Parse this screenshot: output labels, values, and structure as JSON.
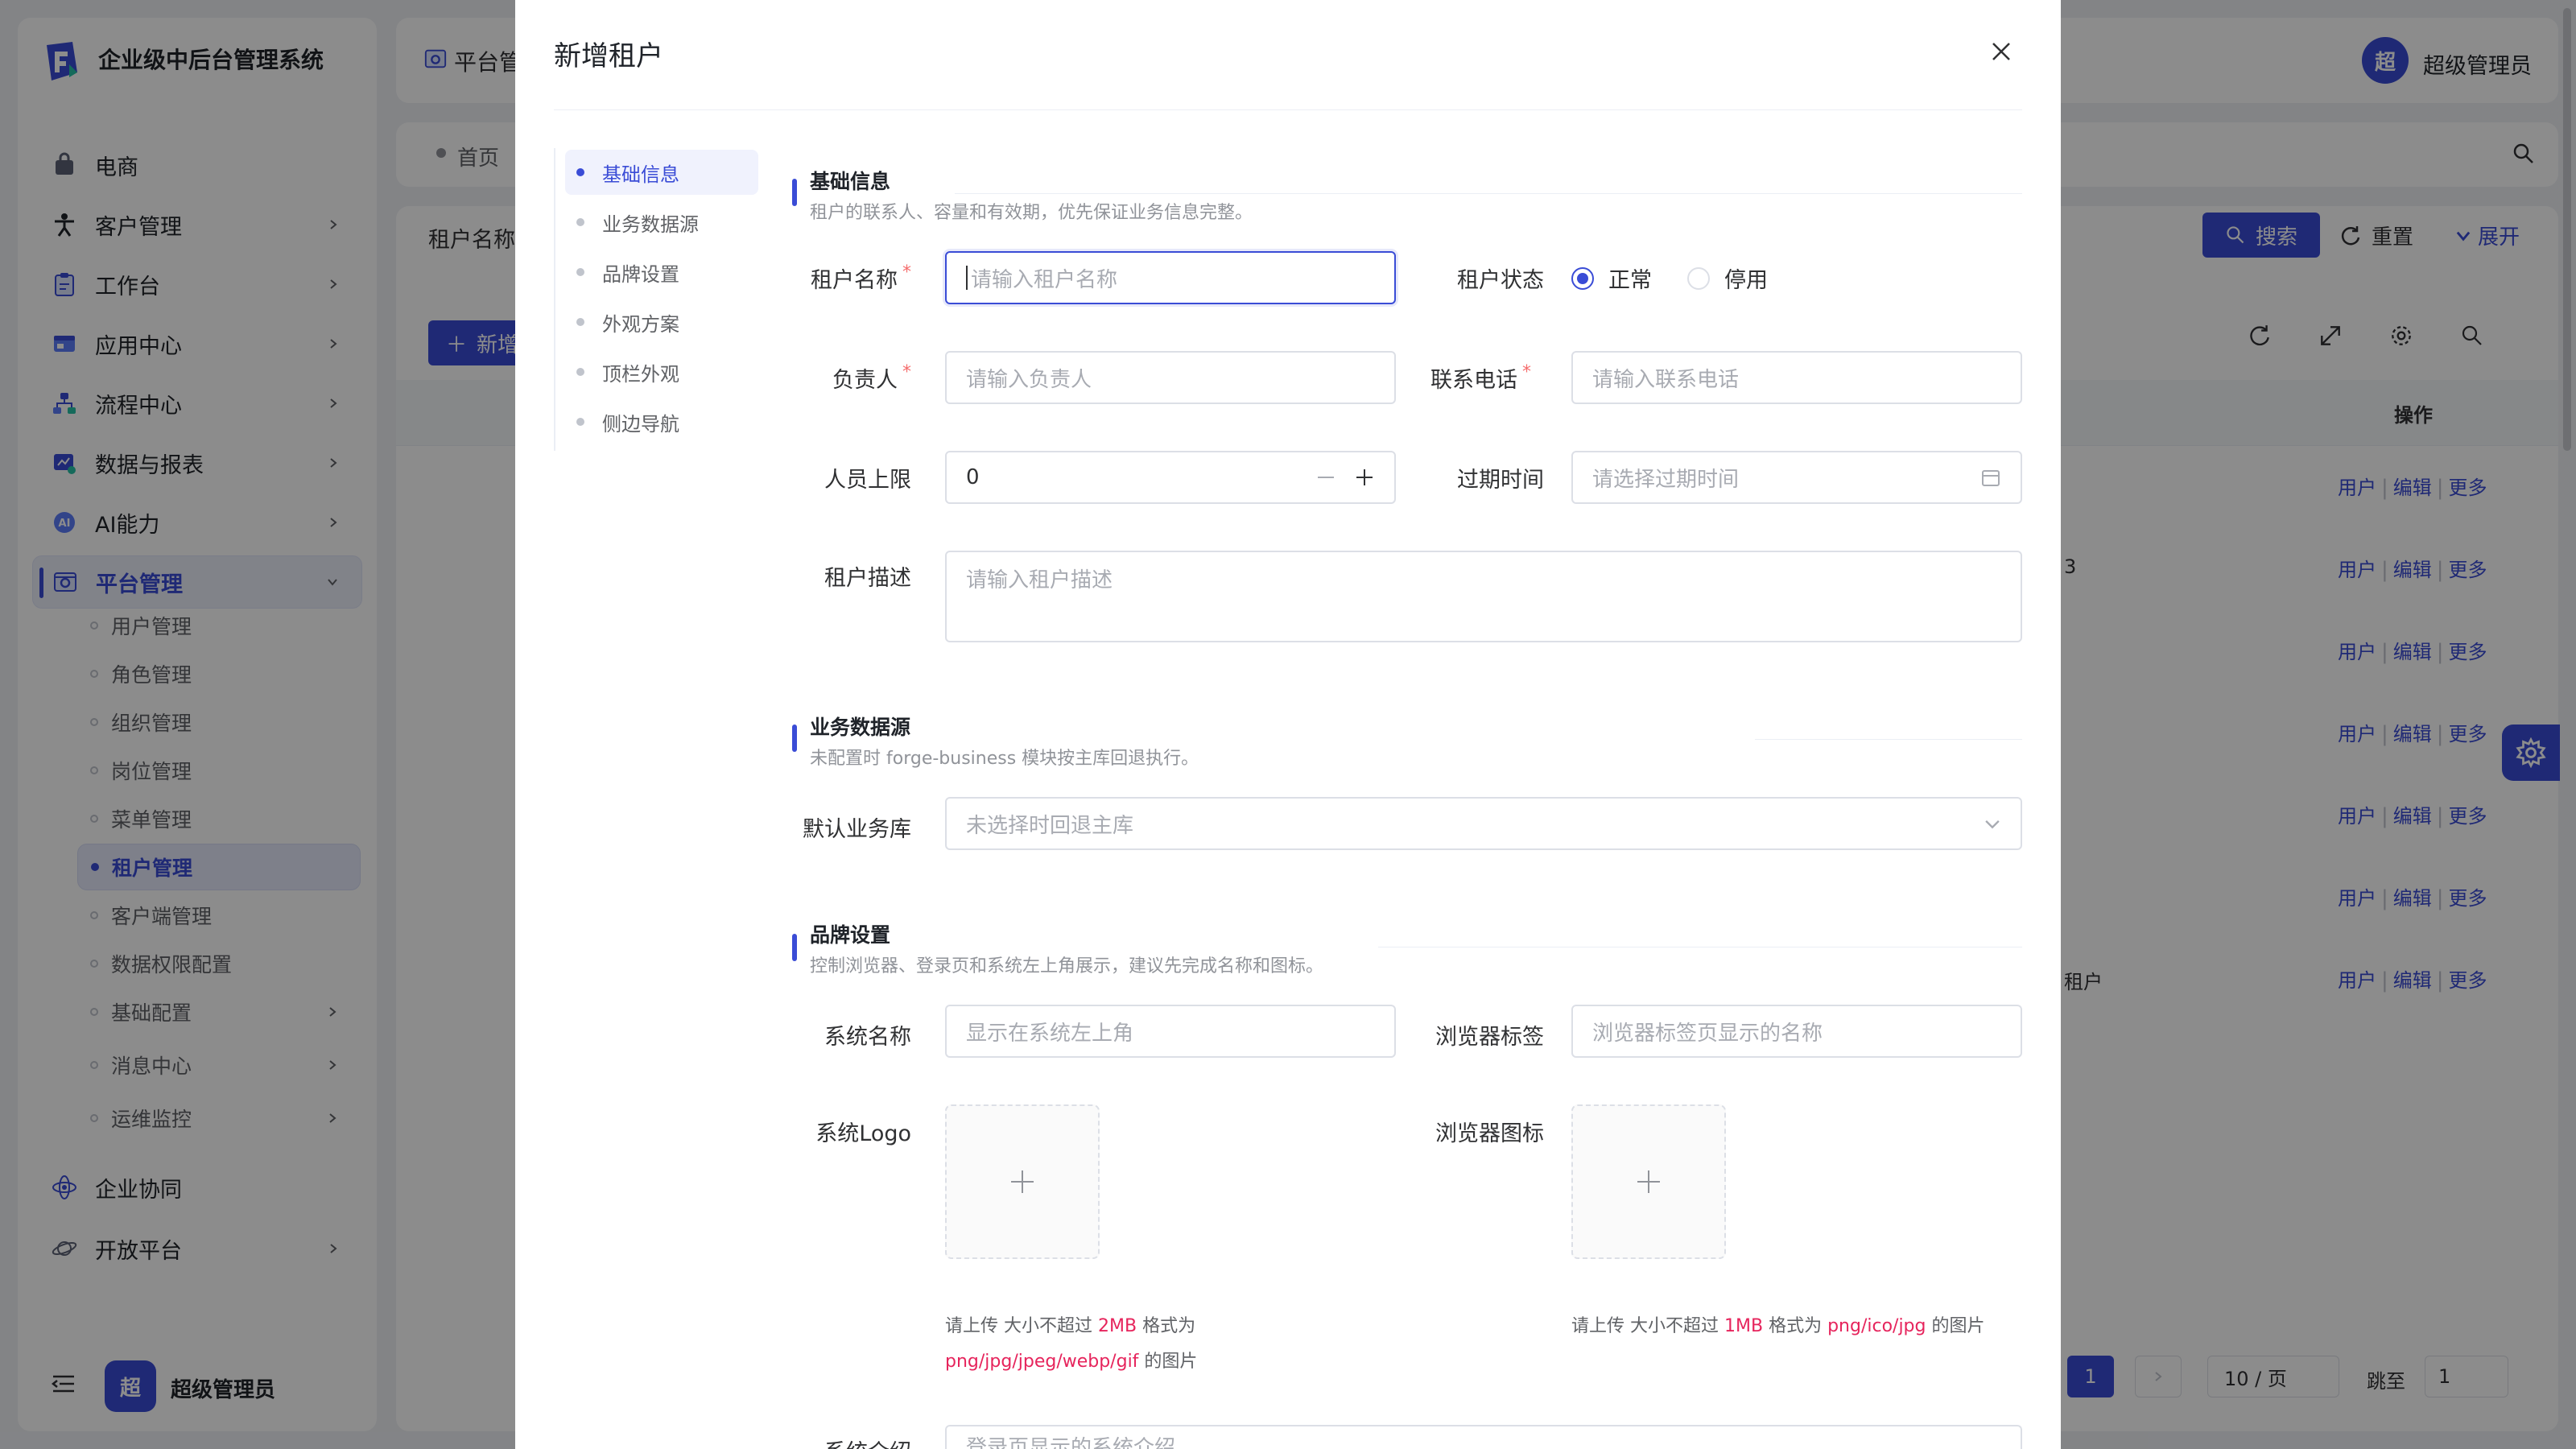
{
  "app": {
    "brand": "企业级中后台管理系统",
    "user_name": "超级管理员",
    "avatar_char": "超",
    "breadcrumb_first": "平台管",
    "tab_home": "首页",
    "search_label_partial": "租户名称",
    "new_btn_partial": "新增",
    "search_btn": "搜索",
    "reset_btn": "重置",
    "expand_btn": "展开",
    "col_action": "操作",
    "row_links": {
      "user": "用户",
      "edit": "编辑",
      "more": "更多"
    },
    "row_partials": [
      "3",
      "租户"
    ],
    "pager_current": "1",
    "page_size": "10 / 页",
    "jump_label": "跳至",
    "jump_value": "1"
  },
  "sidebar": {
    "menu": [
      {
        "label": "电商",
        "icon": "bag-icon",
        "chev": false
      },
      {
        "label": "客户管理",
        "icon": "person-icon",
        "chev": true
      },
      {
        "label": "工作台",
        "icon": "clipboard-icon",
        "chev": true
      },
      {
        "label": "应用中心",
        "icon": "app-window-icon",
        "chev": true
      },
      {
        "label": "流程中心",
        "icon": "flow-icon",
        "chev": true
      },
      {
        "label": "数据与报表",
        "icon": "report-icon",
        "chev": true
      },
      {
        "label": "AI能力",
        "icon": "ai-icon",
        "chev": true
      },
      {
        "label": "平台管理",
        "icon": "platform-icon",
        "chev": true
      }
    ],
    "submenu": [
      {
        "label": "用户管理"
      },
      {
        "label": "角色管理"
      },
      {
        "label": "组织管理"
      },
      {
        "label": "岗位管理"
      },
      {
        "label": "菜单管理"
      },
      {
        "label": "租户管理"
      },
      {
        "label": "客户端管理"
      },
      {
        "label": "数据权限配置"
      },
      {
        "label": "基础配置"
      },
      {
        "label": "消息中心"
      },
      {
        "label": "运维监控"
      }
    ],
    "bottom_menu": [
      {
        "label": "企业协同"
      },
      {
        "label": "开放平台"
      }
    ]
  },
  "modal": {
    "title": "新增租户",
    "anchors": [
      "基础信息",
      "业务数据源",
      "品牌设置",
      "外观方案",
      "顶栏外观",
      "侧边导航"
    ],
    "sections": {
      "basic": {
        "title": "基础信息",
        "desc": "租户的联系人、容量和有效期，优先保证业务信息完整。"
      },
      "datasource": {
        "title": "业务数据源",
        "desc": "未配置时 forge-business 模块按主库回退执行。"
      },
      "brand": {
        "title": "品牌设置",
        "desc": "控制浏览器、登录页和系统左上角展示，建议先完成名称和图标。"
      }
    },
    "fields": {
      "tenant_name": {
        "label": "租户名称",
        "placeholder": "请输入租户名称"
      },
      "tenant_status": {
        "label": "租户状态",
        "options": [
          "正常",
          "停用"
        ],
        "selected": "正常"
      },
      "owner": {
        "label": "负责人",
        "placeholder": "请输入负责人"
      },
      "phone": {
        "label": "联系电话",
        "placeholder": "请输入联系电话"
      },
      "staff_limit": {
        "label": "人员上限",
        "value": "0"
      },
      "expire": {
        "label": "过期时间",
        "placeholder": "请选择过期时间"
      },
      "desc": {
        "label": "租户描述",
        "placeholder": "请输入租户描述"
      },
      "default_db": {
        "label": "默认业务库",
        "placeholder": "未选择时回退主库"
      },
      "sys_name": {
        "label": "系统名称",
        "placeholder": "显示在系统左上角"
      },
      "browser_tab": {
        "label": "浏览器标签",
        "placeholder": "浏览器标签页显示的名称"
      },
      "sys_logo": {
        "label": "系统Logo"
      },
      "browser_icon": {
        "label": "浏览器图标"
      },
      "sys_intro": {
        "label": "系统介绍",
        "placeholder": "登录页显示的系统介绍"
      }
    },
    "logo_hint": {
      "pre": "请上传 大小不超过 ",
      "size": "2MB",
      "mid": " 格式为",
      "formats": "png/jpg/jpeg/webp/gif",
      "post": " 的图片"
    },
    "icon_hint": {
      "pre": "请上传 大小不超过 ",
      "size": "1MB",
      "mid": " 格式为 ",
      "formats": "png/ico/jpg",
      "post": " 的图片"
    }
  },
  "colors": {
    "primary": "#3a4cd6",
    "required": "#f56c6c",
    "hint_em": "#e6245c"
  }
}
